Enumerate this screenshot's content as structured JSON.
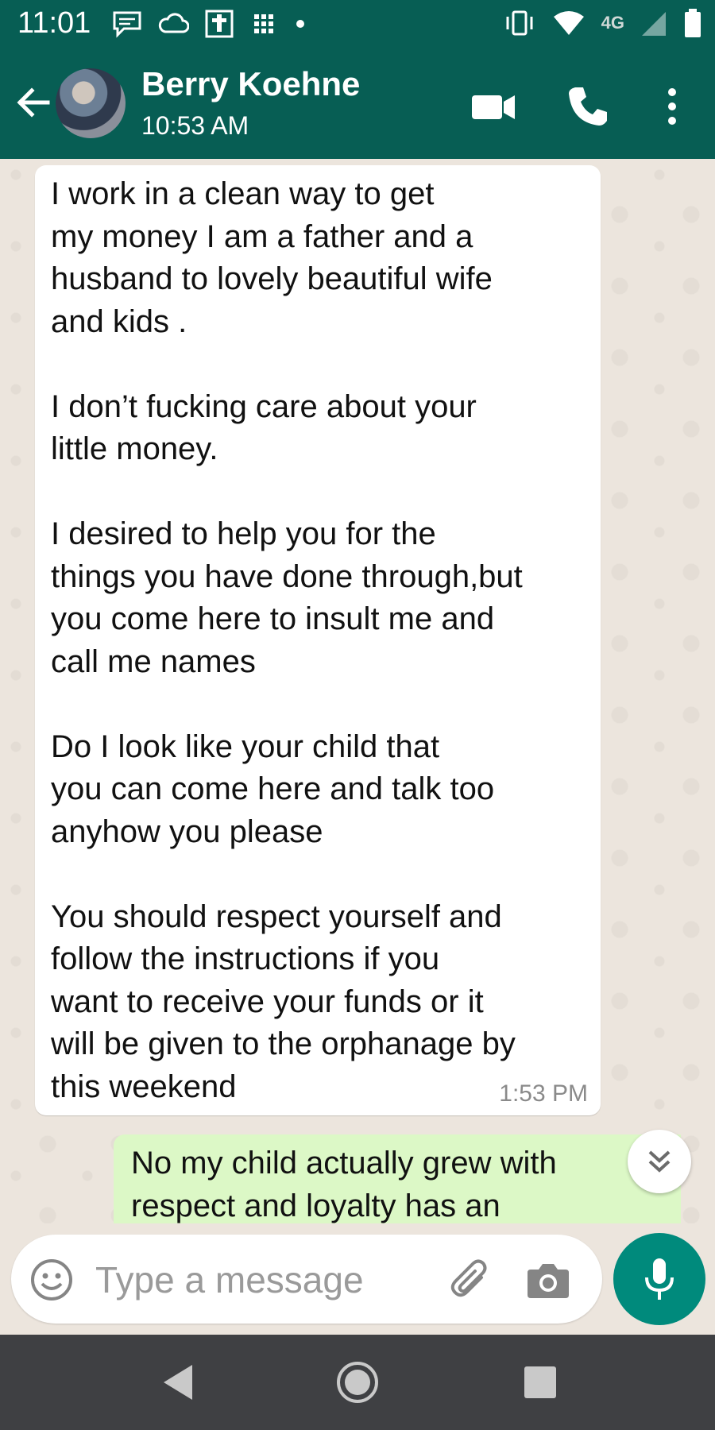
{
  "status_bar": {
    "time": "11:01",
    "network": "4G",
    "icons": [
      "message-notification-icon",
      "cloud-icon",
      "bible-app-icon",
      "grid-icon",
      "dot-icon",
      "vibrate-icon",
      "wifi-icon",
      "signal-icon",
      "battery-icon"
    ]
  },
  "header": {
    "contact_name": "Berry Koehne",
    "subtitle": "10:53 AM",
    "icons": [
      "back-arrow-icon",
      "video-call-icon",
      "phone-icon",
      "more-options-icon"
    ]
  },
  "messages": [
    {
      "direction": "incoming",
      "paragraphs": [
        "I work in a clean way to get\nmy money I am a father and a\nhusband to lovely beautiful wife\nand kids .",
        "I don’t fucking care about your\nlittle money.",
        "I desired to help you for the\nthings you have done through,but\nyou come here to insult me and\ncall me names",
        "Do I look like your child that\nyou can come here and talk too\nanyhow you please",
        "You should respect yourself and\nfollow the instructions if you\nwant to receive your funds or it\nwill be given to the orphanage by\nthis weekend"
      ],
      "time": "1:53 PM"
    },
    {
      "direction": "outgoing",
      "text": "No my child actually grew with\nrespect and loyalty has an"
    }
  ],
  "input": {
    "placeholder": "Type a message"
  },
  "colors": {
    "header": "#075e54",
    "chat_bg": "#ece5dd",
    "incoming_bubble": "#ffffff",
    "outgoing_bubble": "#dcf8c6",
    "mic_button": "#008a7c",
    "nav_bar": "#3f4043"
  }
}
